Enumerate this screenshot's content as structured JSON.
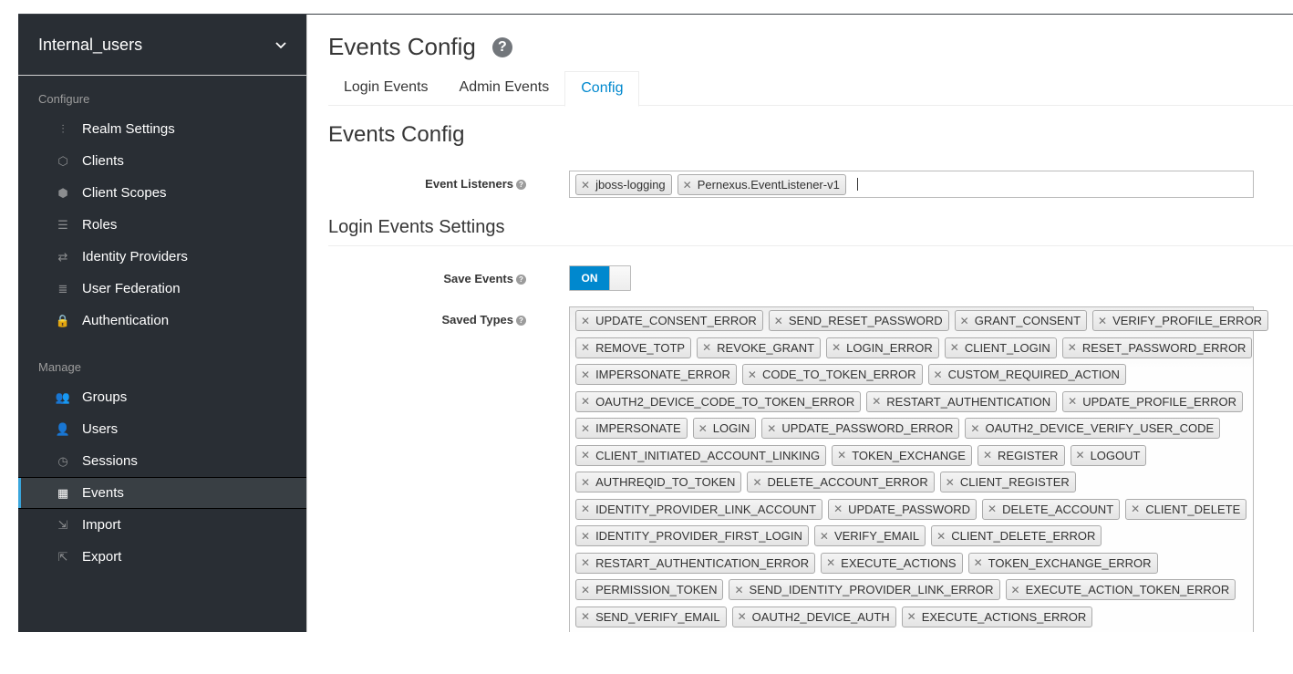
{
  "realm": {
    "name": "Internal_users"
  },
  "sidebar": {
    "configure_title": "Configure",
    "configure_items": [
      {
        "label": "Realm Settings",
        "icon": "sliders-icon"
      },
      {
        "label": "Clients",
        "icon": "cube-icon"
      },
      {
        "label": "Client Scopes",
        "icon": "cubes-icon"
      },
      {
        "label": "Roles",
        "icon": "list-icon"
      },
      {
        "label": "Identity Providers",
        "icon": "exchange-icon"
      },
      {
        "label": "User Federation",
        "icon": "database-icon"
      },
      {
        "label": "Authentication",
        "icon": "lock-icon"
      }
    ],
    "manage_title": "Manage",
    "manage_items": [
      {
        "label": "Groups",
        "icon": "users-icon"
      },
      {
        "label": "Users",
        "icon": "user-icon"
      },
      {
        "label": "Sessions",
        "icon": "clock-icon"
      },
      {
        "label": "Events",
        "icon": "calendar-icon",
        "active": true
      },
      {
        "label": "Import",
        "icon": "import-icon"
      },
      {
        "label": "Export",
        "icon": "export-icon"
      }
    ]
  },
  "page": {
    "title": "Events Config",
    "tabs": [
      "Login Events",
      "Admin Events",
      "Config"
    ],
    "active_tab": "Config",
    "section_title": "Events Config",
    "event_listeners_label": "Event Listeners",
    "event_listeners": [
      "jboss-logging",
      "Pernexus.EventListener-v1"
    ],
    "login_settings_title": "Login Events Settings",
    "save_events_label": "Save Events",
    "save_events_value": "ON",
    "saved_types_label": "Saved Types",
    "saved_types_rows": [
      [
        "UPDATE_CONSENT_ERROR",
        "SEND_RESET_PASSWORD",
        "GRANT_CONSENT",
        "VERIFY_PROFILE_ERROR"
      ],
      [
        "REMOVE_TOTP",
        "REVOKE_GRANT",
        "LOGIN_ERROR",
        "CLIENT_LOGIN",
        "RESET_PASSWORD_ERROR"
      ],
      [
        "IMPERSONATE_ERROR",
        "CODE_TO_TOKEN_ERROR",
        "CUSTOM_REQUIRED_ACTION"
      ],
      [
        "OAUTH2_DEVICE_CODE_TO_TOKEN_ERROR",
        "RESTART_AUTHENTICATION",
        "UPDATE_PROFILE_ERROR"
      ],
      [
        "IMPERSONATE",
        "LOGIN",
        "UPDATE_PASSWORD_ERROR",
        "OAUTH2_DEVICE_VERIFY_USER_CODE"
      ],
      [
        "CLIENT_INITIATED_ACCOUNT_LINKING",
        "TOKEN_EXCHANGE",
        "REGISTER",
        "LOGOUT"
      ],
      [
        "AUTHREQID_TO_TOKEN",
        "DELETE_ACCOUNT_ERROR",
        "CLIENT_REGISTER"
      ],
      [
        "IDENTITY_PROVIDER_LINK_ACCOUNT",
        "UPDATE_PASSWORD",
        "DELETE_ACCOUNT",
        "CLIENT_DELETE"
      ],
      [
        "IDENTITY_PROVIDER_FIRST_LOGIN",
        "VERIFY_EMAIL",
        "CLIENT_DELETE_ERROR"
      ],
      [
        "RESTART_AUTHENTICATION_ERROR",
        "EXECUTE_ACTIONS",
        "TOKEN_EXCHANGE_ERROR"
      ],
      [
        "PERMISSION_TOKEN",
        "SEND_IDENTITY_PROVIDER_LINK_ERROR",
        "EXECUTE_ACTION_TOKEN_ERROR"
      ],
      [
        "SEND_VERIFY_EMAIL",
        "OAUTH2_DEVICE_AUTH",
        "EXECUTE_ACTIONS_ERROR"
      ]
    ]
  }
}
